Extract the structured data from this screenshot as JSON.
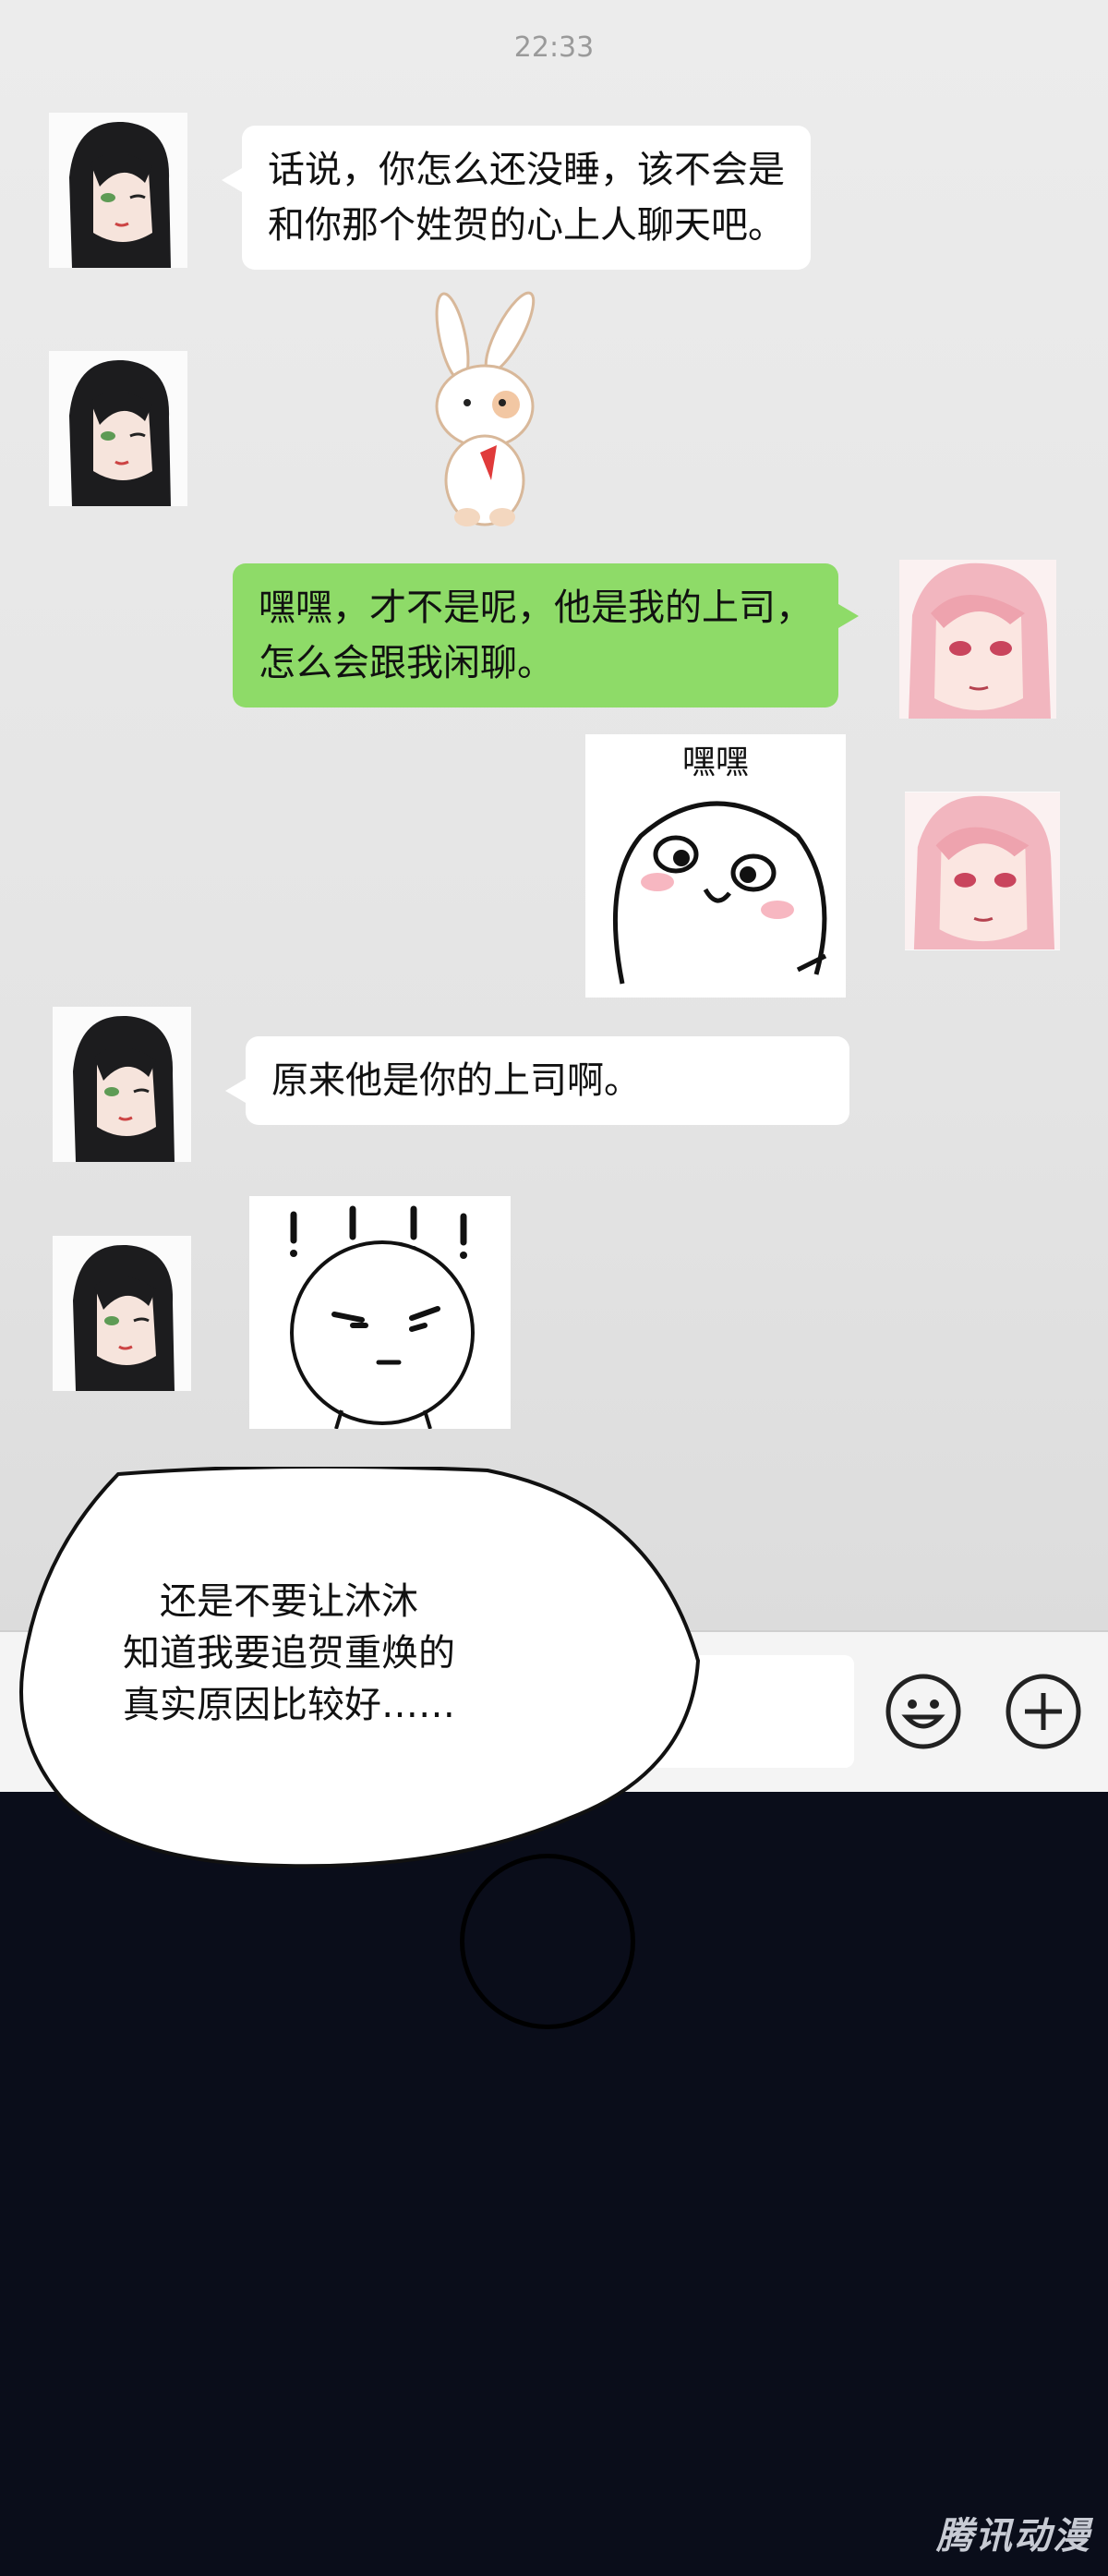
{
  "status": {
    "time": "22:33"
  },
  "messages": [
    {
      "lines": [
        "话说，你怎么还没睡，该不会是",
        "和你那个姓贺的心上人聊天吧。"
      ]
    },
    {
      "sticker": "bunny-holding-strawberry"
    },
    {
      "lines": [
        "嘿嘿，才不是呢，他是我的上司，",
        "怎么会跟我闲聊。"
      ]
    },
    {
      "sticker": "grinning-blob",
      "sticker_text": "嘿嘿"
    },
    {
      "lines": [
        "原来他是你的上司啊。"
      ]
    },
    {
      "sticker": "shocked-frowning-face"
    }
  ],
  "input_bar": {
    "left_icon": "voice-icon",
    "right_icons": [
      "emoji-icon",
      "plus-icon"
    ]
  },
  "caption": {
    "lines": [
      "还是不要让沐沐",
      "知道我要追贺重焕的",
      "真实原因比较好……"
    ]
  },
  "watermark": "腾讯动漫",
  "colors": {
    "sent_bubble": "#8edb68",
    "received_bubble": "#ffffff",
    "background": "#e8e8e8",
    "dark_area": "#0a0d1a"
  }
}
